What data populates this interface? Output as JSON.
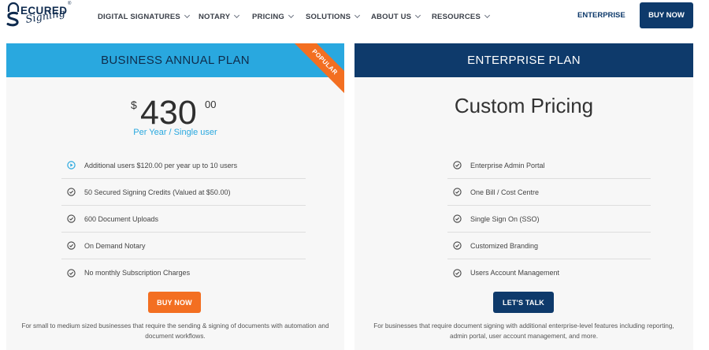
{
  "brand": {
    "logo_top": "ECURED",
    "logo_bottom": "Signing",
    "logo_reg": "®"
  },
  "nav": {
    "items": [
      {
        "label": "DIGITAL SIGNATURES"
      },
      {
        "label": "NOTARY"
      },
      {
        "label": "PRICING"
      },
      {
        "label": "SOLUTIONS"
      },
      {
        "label": "ABOUT US"
      },
      {
        "label": "RESOURCES"
      }
    ],
    "enterprise_label": "ENTERPRISE",
    "buy_now_label": "BUY NOW"
  },
  "colors": {
    "navy": "#0e3a6b",
    "sky_blue": "#29a8df",
    "orange": "#f36f21",
    "card_bg": "#f7f7f7"
  },
  "plans": {
    "business": {
      "title": "BUSINESS ANNUAL PLAN",
      "badge": "POPULAR",
      "currency": "$",
      "amount": "430",
      "cents": "00",
      "period": "Per Year / Single user",
      "features": [
        {
          "text": "Additional users $120.00 per year up to 10 users",
          "icon": "play-circle-icon"
        },
        {
          "text": "50 Secured Signing Credits (Valued at $50.00)",
          "icon": "check-circle-icon"
        },
        {
          "text": "600 Document Uploads",
          "icon": "check-circle-icon"
        },
        {
          "text": "On Demand Notary",
          "icon": "check-circle-icon"
        },
        {
          "text": "No monthly Subscription Charges",
          "icon": "check-circle-icon"
        }
      ],
      "cta_label": "BUY NOW",
      "description": "For small to medium sized businesses that require the sending & signing of documents with automation and document workflows."
    },
    "enterprise": {
      "title": "ENTERPRISE PLAN",
      "price_text": "Custom Pricing",
      "features": [
        {
          "text": "Enterprise Admin Portal",
          "icon": "check-circle-icon"
        },
        {
          "text": "One Bill / Cost Centre",
          "icon": "check-circle-icon"
        },
        {
          "text": "Single Sign On (SSO)",
          "icon": "check-circle-icon"
        },
        {
          "text": "Customized Branding",
          "icon": "check-circle-icon"
        },
        {
          "text": "Users Account Management",
          "icon": "check-circle-icon"
        }
      ],
      "cta_label": "LET'S TALK",
      "description": "For businesses that require document signing with additional enterprise-level features including reporting, admin portal, user account management, and more."
    }
  }
}
